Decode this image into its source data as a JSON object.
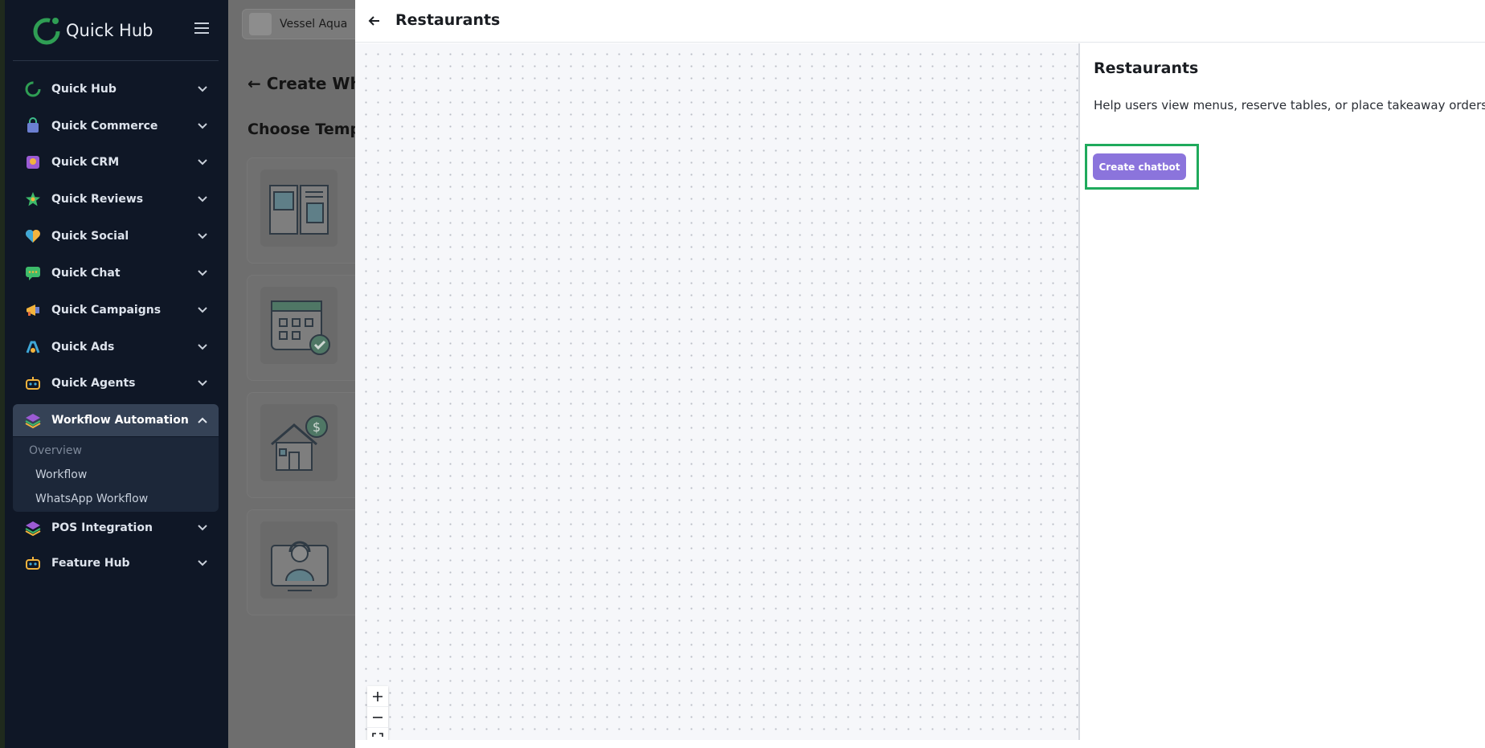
{
  "sidebar": {
    "brand": "Quick Hub",
    "items": [
      {
        "label": "Quick Hub",
        "icon": "quick-hub-icon"
      },
      {
        "label": "Quick Commerce",
        "icon": "shopping-bag-icon"
      },
      {
        "label": "Quick CRM",
        "icon": "crm-icon"
      },
      {
        "label": "Quick Reviews",
        "icon": "star-icon"
      },
      {
        "label": "Quick Social",
        "icon": "heart-icon"
      },
      {
        "label": "Quick Chat",
        "icon": "chat-bubble-icon"
      },
      {
        "label": "Quick Campaigns",
        "icon": "megaphone-icon"
      },
      {
        "label": "Quick Ads",
        "icon": "ads-icon"
      },
      {
        "label": "Quick Agents",
        "icon": "robot-icon"
      },
      {
        "label": "Workflow Automation",
        "icon": "layers-icon"
      },
      {
        "label": "POS Integration",
        "icon": "layers-icon"
      },
      {
        "label": "Feature Hub",
        "icon": "robot-icon"
      }
    ],
    "submenu": {
      "overview": "Overview",
      "workflow": "Workflow",
      "whatsapp_workflow": "WhatsApp Workflow"
    }
  },
  "main": {
    "org_name": "Vessel Aqua",
    "page_title": "← Create Wha",
    "section_title": "Choose Templ",
    "template_icons": [
      "menu-book-icon",
      "calendar-check-icon",
      "house-dollar-icon",
      "support-agent-icon"
    ]
  },
  "drawer": {
    "title": "Restaurants",
    "detail_title": "Restaurants",
    "description": "Help users view menus, reserve tables, or place takeaway orders.",
    "create_button": "Create chatbot",
    "accent_color": "#8b74dc",
    "highlight_color": "#1faa5c"
  }
}
